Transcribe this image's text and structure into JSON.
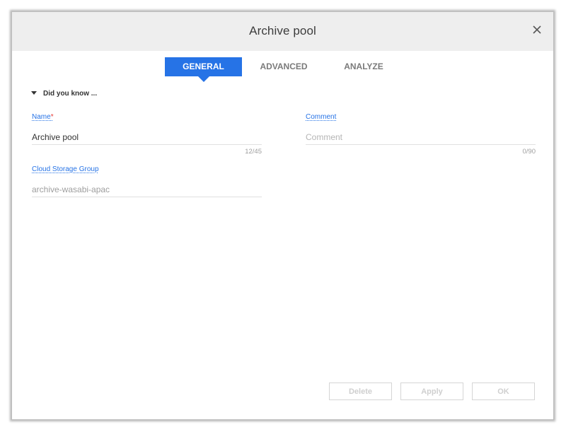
{
  "dialog": {
    "title": "Archive pool",
    "close_icon": "close-icon"
  },
  "tabs": [
    {
      "label": "GENERAL",
      "active": true
    },
    {
      "label": "ADVANCED",
      "active": false
    },
    {
      "label": "ANALYZE",
      "active": false
    }
  ],
  "did_you_know": {
    "label": "Did you know ...",
    "icon": "caret-down-icon"
  },
  "fields": {
    "name": {
      "label": "Name",
      "required_mark": "*",
      "value": "Archive pool",
      "counter": "12/45"
    },
    "comment": {
      "label": "Comment",
      "value": "",
      "placeholder": "Comment",
      "counter": "0/90"
    },
    "cloud_storage_group": {
      "label": "Cloud Storage Group",
      "value": "archive-wasabi-apac"
    }
  },
  "buttons": {
    "delete": "Delete",
    "apply": "Apply",
    "ok": "OK"
  },
  "colors": {
    "accent": "#2673e6",
    "header_bg": "#eeeeee",
    "required": "#e53935"
  }
}
